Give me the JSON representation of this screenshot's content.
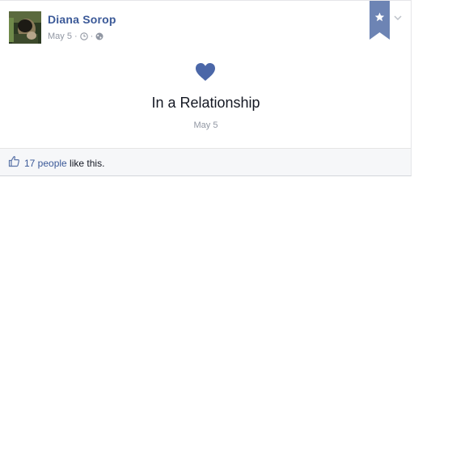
{
  "post": {
    "author": "Diana Sorop",
    "date": "May 5",
    "meta_separator": "·",
    "icons": {
      "time": "clock-icon",
      "privacy": "globe-icon",
      "highlight": "star-ribbon-icon",
      "options": "chevron-down-icon"
    }
  },
  "life_event": {
    "icon": "heart-icon",
    "title": "In a Relationship",
    "date": "May 5"
  },
  "likes": {
    "icon": "thumbs-up-icon",
    "count_link": "17 people",
    "suffix": " like this."
  },
  "colors": {
    "accent": "#3b5998",
    "heart": "#4b67a8",
    "ribbon": "#6d84b4",
    "muted": "#9197a3",
    "footer_bg": "#f6f7f9"
  }
}
